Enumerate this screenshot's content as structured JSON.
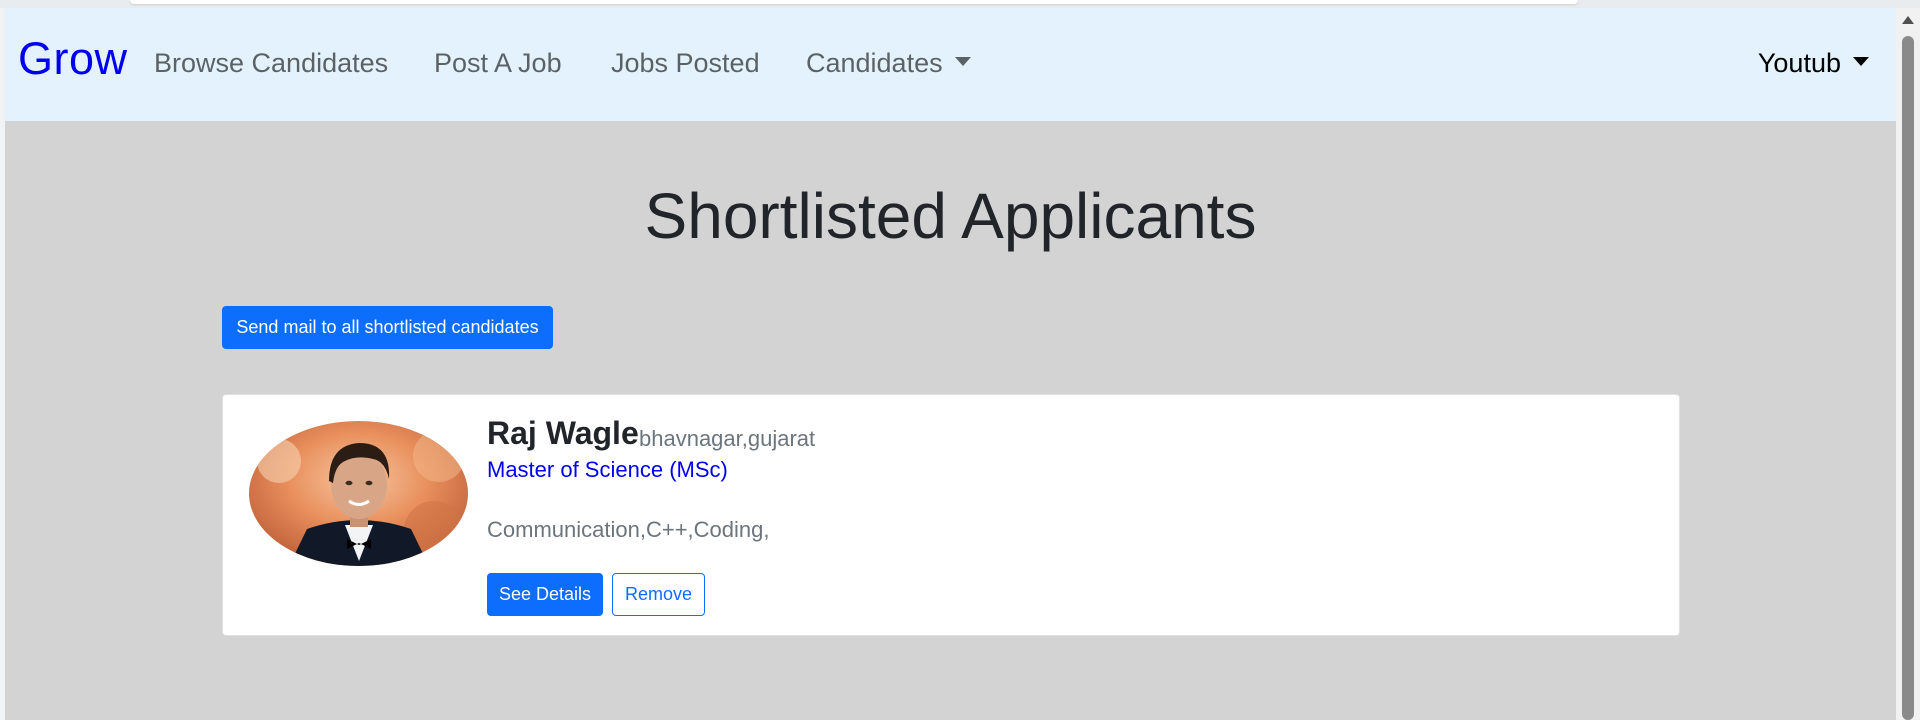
{
  "navbar": {
    "brand": "Grow",
    "links": [
      {
        "label": "Browse Candidates"
      },
      {
        "label": "Post A Job"
      },
      {
        "label": "Jobs Posted"
      },
      {
        "label": "Candidates"
      }
    ],
    "user": "Youtub"
  },
  "main": {
    "title": "Shortlisted Applicants",
    "mail_button": "Send mail to all shortlisted candidates"
  },
  "candidates": [
    {
      "name": "Raj Wagle",
      "location": "bhavnagar,gujarat",
      "degree": "Master of Science (MSc)",
      "skills": "Communication,C++,Coding,",
      "details_button": "See Details",
      "remove_button": "Remove"
    }
  ],
  "colors": {
    "navbar_bg": "#e3f2fd",
    "page_bg": "#d3d3d3",
    "brand": "#0000ee",
    "primary": "#0d6efd"
  }
}
